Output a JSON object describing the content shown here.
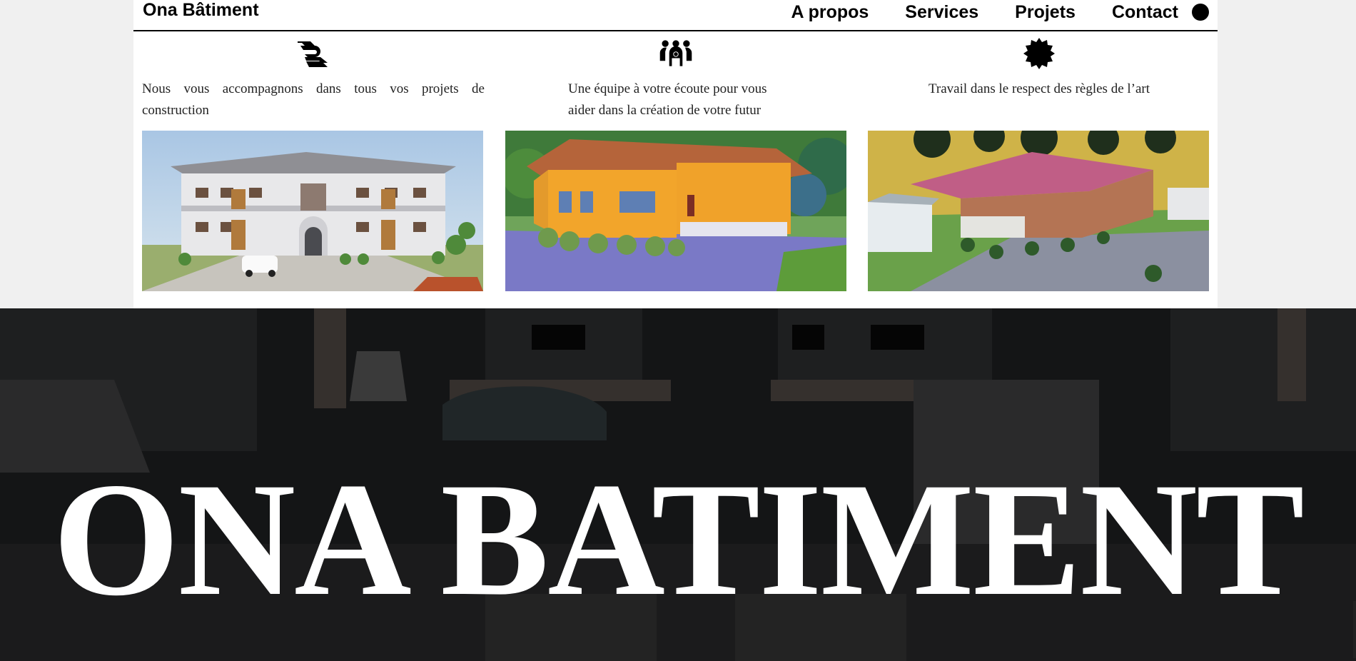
{
  "header": {
    "brand": "Ona Bâtiment",
    "nav": [
      "A propos",
      "Services",
      "Projets",
      "Contact"
    ]
  },
  "features": [
    {
      "icon": "handshake-icon",
      "text": "Nous vous accompagnons dans tous vos projets de construction"
    },
    {
      "icon": "team-icon",
      "text": "Une équipe à votre écoute pour vous aider dans la création de votre futur"
    },
    {
      "icon": "certificate-badge-icon",
      "text": "Travail dans le respect des règles de l’art"
    }
  ],
  "hero": {
    "title": "ONA BATIMENT"
  },
  "colors": {
    "page_background": "#f0f0f0",
    "card_background": "#ffffff",
    "hero_overlay": "#151617",
    "text": "#000000"
  }
}
